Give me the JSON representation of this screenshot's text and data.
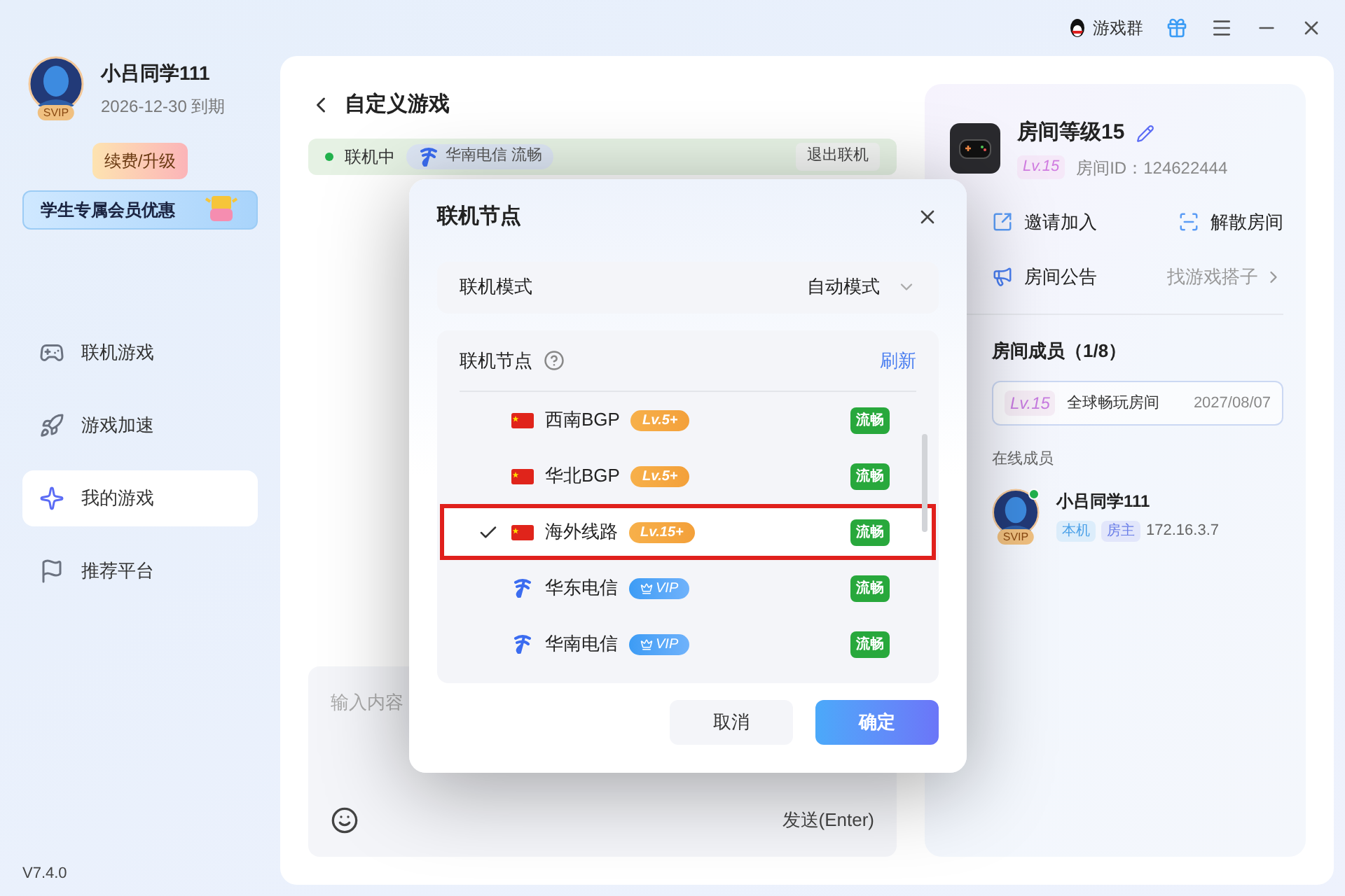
{
  "title_bar": {
    "group_label": "游戏群"
  },
  "user": {
    "name": "小吕同学111",
    "badge": "SVIP",
    "expiry": "2026-12-30 到期",
    "renew_button": "续费/升级",
    "promo_banner": "学生专属会员优惠"
  },
  "nav": [
    {
      "label": "联机游戏",
      "selected": false
    },
    {
      "label": "游戏加速",
      "selected": false
    },
    {
      "label": "我的游戏",
      "selected": true
    },
    {
      "label": "推荐平台",
      "selected": false
    }
  ],
  "version": "V7.4.0",
  "page": {
    "title": "自定义游戏",
    "status": "联机中",
    "node_chip": "华南电信 流畅",
    "exit_button": "退出联机",
    "message_placeholder": "输入内容",
    "send_button": "发送(Enter)"
  },
  "room": {
    "name": "房间等级15",
    "level": "Lv.15",
    "room_id": "房间ID：124622444",
    "actions": [
      "邀请加入",
      "解散房间"
    ],
    "announcement_label": "房间公告",
    "announcement_value": "找游戏搭子",
    "members_title": "房间成员（1/8）",
    "plan": {
      "level": "Lv.15",
      "name": "全球畅玩房间",
      "date": "2027/08/07"
    },
    "online_title": "在线成员",
    "members": [
      {
        "name": "小吕同学111",
        "badge": "SVIP",
        "online": true,
        "tags": [
          "本机",
          "房主"
        ],
        "ip": "172.16.3.7"
      }
    ]
  },
  "dialog": {
    "title": "联机节点",
    "mode_label": "联机模式",
    "mode_value": "自动模式",
    "nodes_label": "联机节点",
    "refresh": "刷新",
    "nodes": [
      {
        "kind": "flag",
        "name": "西南BGP",
        "badge": {
          "kind": "level",
          "text": "Lv.5+"
        },
        "status": "流畅",
        "selected": false
      },
      {
        "kind": "flag",
        "name": "华北BGP",
        "badge": {
          "kind": "level",
          "text": "Lv.5+"
        },
        "status": "流畅",
        "selected": false
      },
      {
        "kind": "flag",
        "name": "海外线路",
        "badge": {
          "kind": "level",
          "text": "Lv.15+"
        },
        "status": "流畅",
        "selected": true
      },
      {
        "kind": "telecom",
        "name": "华东电信",
        "badge": {
          "kind": "vip",
          "text": "VIP"
        },
        "status": "流畅",
        "selected": false
      },
      {
        "kind": "telecom",
        "name": "华南电信",
        "badge": {
          "kind": "vip",
          "text": "VIP"
        },
        "status": "流畅",
        "selected": false
      }
    ],
    "cancel": "取消",
    "confirm": "确定"
  }
}
